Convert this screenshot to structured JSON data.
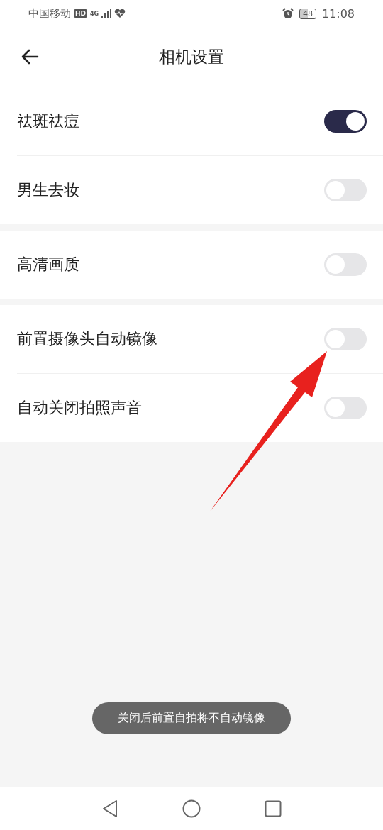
{
  "status_bar": {
    "carrier": "中国移动",
    "hd": "HD",
    "network": "4G",
    "battery": "48",
    "time": "11:08"
  },
  "header": {
    "title": "相机设置"
  },
  "groups": [
    {
      "items": [
        {
          "label": "祛斑祛痘",
          "on": true
        },
        {
          "label": "男生去妆",
          "on": false
        }
      ]
    },
    {
      "items": [
        {
          "label": "高清画质",
          "on": false
        }
      ]
    },
    {
      "items": [
        {
          "label": "前置摄像头自动镜像",
          "on": false
        },
        {
          "label": "自动关闭拍照声音",
          "on": false
        }
      ]
    }
  ],
  "toast": "关闭后前置自拍将不自动镜像"
}
